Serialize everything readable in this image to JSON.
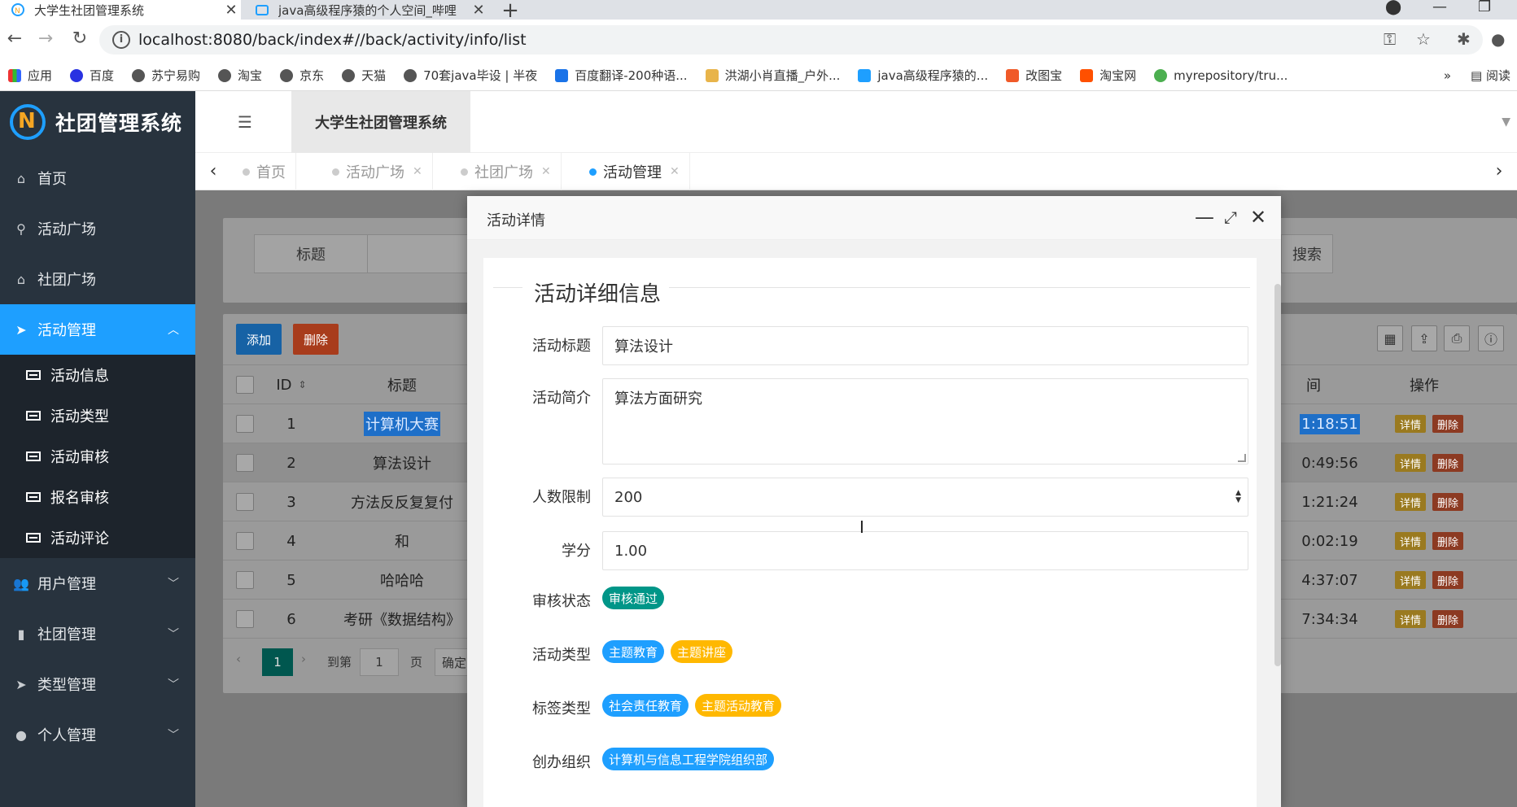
{
  "browser": {
    "tabs": [
      {
        "title": "大学生社团管理系统",
        "active": true
      },
      {
        "title": "java高级程序猿的个人空间_哔哩",
        "active": false
      }
    ],
    "url": "localhost:8080/back/index#//back/activity/info/list",
    "bookmarks": [
      "应用",
      "百度",
      "苏宁易购",
      "淘宝",
      "京东",
      "天猫",
      "70套java毕设 | 半夜",
      "百度翻译-200种语...",
      "洪湖小肖直播_户外...",
      "java高级程序猿的...",
      "改图宝",
      "淘宝网",
      "myrepository/tru..."
    ],
    "bookmarks_more": "»",
    "reading_list": "阅读"
  },
  "app": {
    "logo_text": "社团管理系统",
    "header_title": "大学生社团管理系统",
    "menu": [
      {
        "label": "首页",
        "icon": "home-icon"
      },
      {
        "label": "活动广场",
        "icon": "bicycle-icon"
      },
      {
        "label": "社团广场",
        "icon": "bank-icon"
      },
      {
        "label": "活动管理",
        "icon": "send-icon",
        "active": true
      }
    ],
    "submenu": [
      "活动信息",
      "活动类型",
      "活动审核",
      "报名审核",
      "活动评论"
    ],
    "menu_bottom": [
      {
        "label": "用户管理",
        "icon": "users-icon"
      },
      {
        "label": "社团管理",
        "icon": "book-icon"
      },
      {
        "label": "类型管理",
        "icon": "send-icon"
      },
      {
        "label": "个人管理",
        "icon": "user-icon"
      }
    ],
    "page_tabs": [
      {
        "label": "首页",
        "closable": false
      },
      {
        "label": "活动广场",
        "closable": true
      },
      {
        "label": "社团广场",
        "closable": true
      },
      {
        "label": "活动管理",
        "closable": true,
        "active": true
      }
    ]
  },
  "list": {
    "search_label": "标题",
    "search_button": "搜索",
    "add_button": "添加",
    "delete_button": "删除",
    "columns": {
      "id": "ID",
      "title": "标题",
      "time_partial": "间",
      "ops": "操作"
    },
    "rows": [
      {
        "id": "1",
        "title": "计算机大赛",
        "time": "1:18:51",
        "selected_text": true
      },
      {
        "id": "2",
        "title": "算法设计",
        "time": "0:49:56"
      },
      {
        "id": "3",
        "title": "方法反反复复付",
        "time": "1:21:24"
      },
      {
        "id": "4",
        "title": "和",
        "time": "0:02:19"
      },
      {
        "id": "5",
        "title": "哈哈哈",
        "time": "4:37:07"
      },
      {
        "id": "6",
        "title": "考研《数据结构》",
        "time": "7:34:34"
      }
    ],
    "detail_button": "详情",
    "row_delete_button": "删除",
    "pager": {
      "current": "1",
      "goto_label": "到第",
      "goto_value": "1",
      "page_unit": "页",
      "confirm": "确定"
    }
  },
  "modal": {
    "title": "活动详情",
    "section_title": "活动详细信息",
    "fields": {
      "title_label": "活动标题",
      "title_value": "算法设计",
      "intro_label": "活动简介",
      "intro_value": "算法方面研究",
      "limit_label": "人数限制",
      "limit_value": "200",
      "credit_label": "学分",
      "credit_value": "1.00",
      "status_label": "审核状态",
      "status_value": "审核通过",
      "type_label": "活动类型",
      "types": [
        "主题教育",
        "主题讲座"
      ],
      "tag_label": "标签类型",
      "tags": [
        "社会责任教育",
        "主题活动教育"
      ],
      "org_label": "创办组织",
      "org_value": "计算机与信息工程学院组织部"
    }
  },
  "colors": {
    "primary": "#1e9fff",
    "danger": "#ff5722",
    "warn": "#ffb800",
    "green": "#009688",
    "sidebar_bg": "#28333e"
  }
}
